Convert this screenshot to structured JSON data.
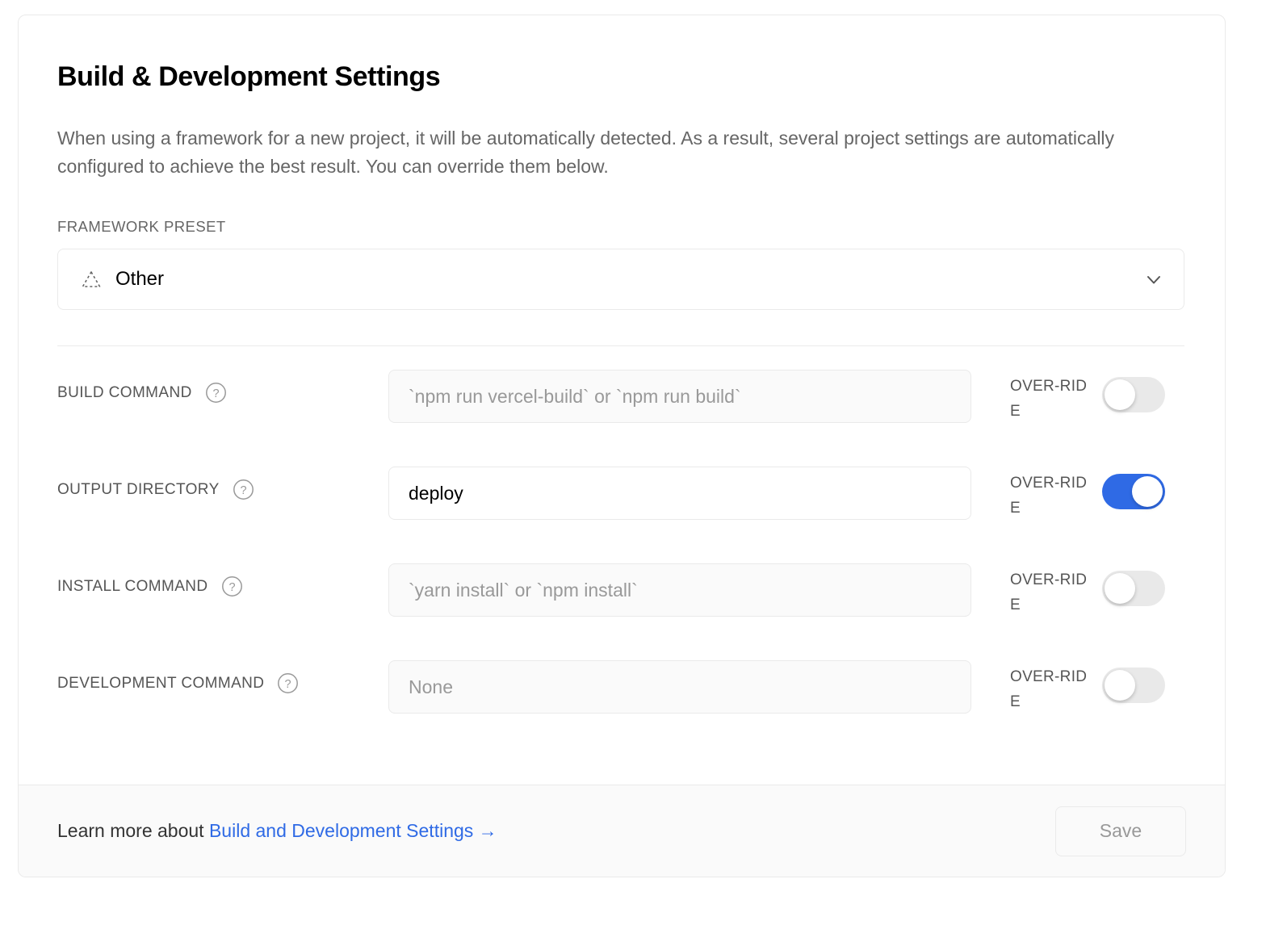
{
  "card": {
    "title": "Build & Development Settings",
    "description": "When using a framework for a new project, it will be automatically detected. As a result, several project settings are automatically configured to achieve the best result. You can override them below."
  },
  "framework_preset": {
    "label": "FRAMEWORK PRESET",
    "value": "Other",
    "icon": "dashed-triangle-icon",
    "chevron_icon": "chevron-down-icon"
  },
  "override_label": "OVER-RIDE",
  "help_icon": "question-mark-circle-icon",
  "rows": [
    {
      "label": "BUILD COMMAND",
      "value": "",
      "placeholder": "`npm run vercel-build` or `npm run build`",
      "override": false,
      "enabled": false
    },
    {
      "label": "OUTPUT DIRECTORY",
      "value": "deploy",
      "placeholder": "",
      "override": true,
      "enabled": true
    },
    {
      "label": "INSTALL COMMAND",
      "value": "",
      "placeholder": "`yarn install` or `npm install`",
      "override": false,
      "enabled": false
    },
    {
      "label": "DEVELOPMENT COMMAND",
      "value": "",
      "placeholder": "None",
      "override": false,
      "enabled": false
    }
  ],
  "footer": {
    "prefix": "Learn more about",
    "link_text": "Build and Development Settings",
    "link_arrow": "→",
    "save_label": "Save"
  },
  "colors": {
    "accent": "#2F6AE5",
    "link": "#2F6AE5",
    "border": "#EAEAEA",
    "toggle_off_track": "#E9E9E9",
    "muted_text": "#666666",
    "footer_bg": "#FAFAFA"
  }
}
